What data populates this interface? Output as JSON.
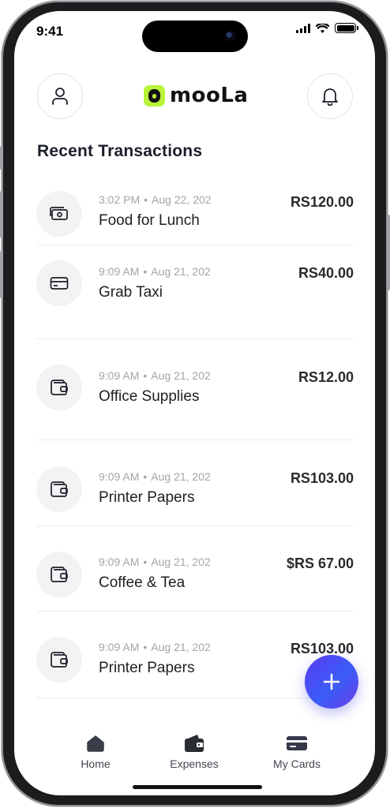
{
  "status_bar": {
    "time": "9:41"
  },
  "header": {
    "logo_text": "mooLa",
    "logo_color": "#b8f23a"
  },
  "section_title": "Recent Transactions",
  "transactions": [
    {
      "time": "3:02 PM",
      "date": "Aug 22, 202",
      "name": "Food for Lunch",
      "amount": "RS120.00",
      "icon": "cash-icon"
    },
    {
      "time": "9:09 AM",
      "date": "Aug 21, 202",
      "name": "Grab Taxi",
      "amount": "RS40.00",
      "icon": "card-icon"
    },
    {
      "time": "9:09 AM",
      "date": "Aug 21, 202",
      "name": "Office Supplies",
      "amount": "RS12.00",
      "icon": "wallet-icon"
    },
    {
      "time": "9:09 AM",
      "date": "Aug 21, 202",
      "name": "Printer Papers",
      "amount": "RS103.00",
      "icon": "wallet-icon"
    },
    {
      "time": "9:09 AM",
      "date": "Aug 21, 202",
      "name": "Coffee & Tea",
      "amount": "$RS 67.00",
      "icon": "wallet-icon"
    },
    {
      "time": "9:09 AM",
      "date": "Aug 21, 202",
      "name": "Printer Papers",
      "amount": "RS103.00",
      "icon": "wallet-icon"
    }
  ],
  "fab": {
    "label": "+",
    "color": "#4a4af0"
  },
  "bottom_nav": [
    {
      "label": "Home",
      "icon": "home-icon"
    },
    {
      "label": "Expenses",
      "icon": "wallet-icon"
    },
    {
      "label": "My Cards",
      "icon": "card-icon"
    }
  ]
}
